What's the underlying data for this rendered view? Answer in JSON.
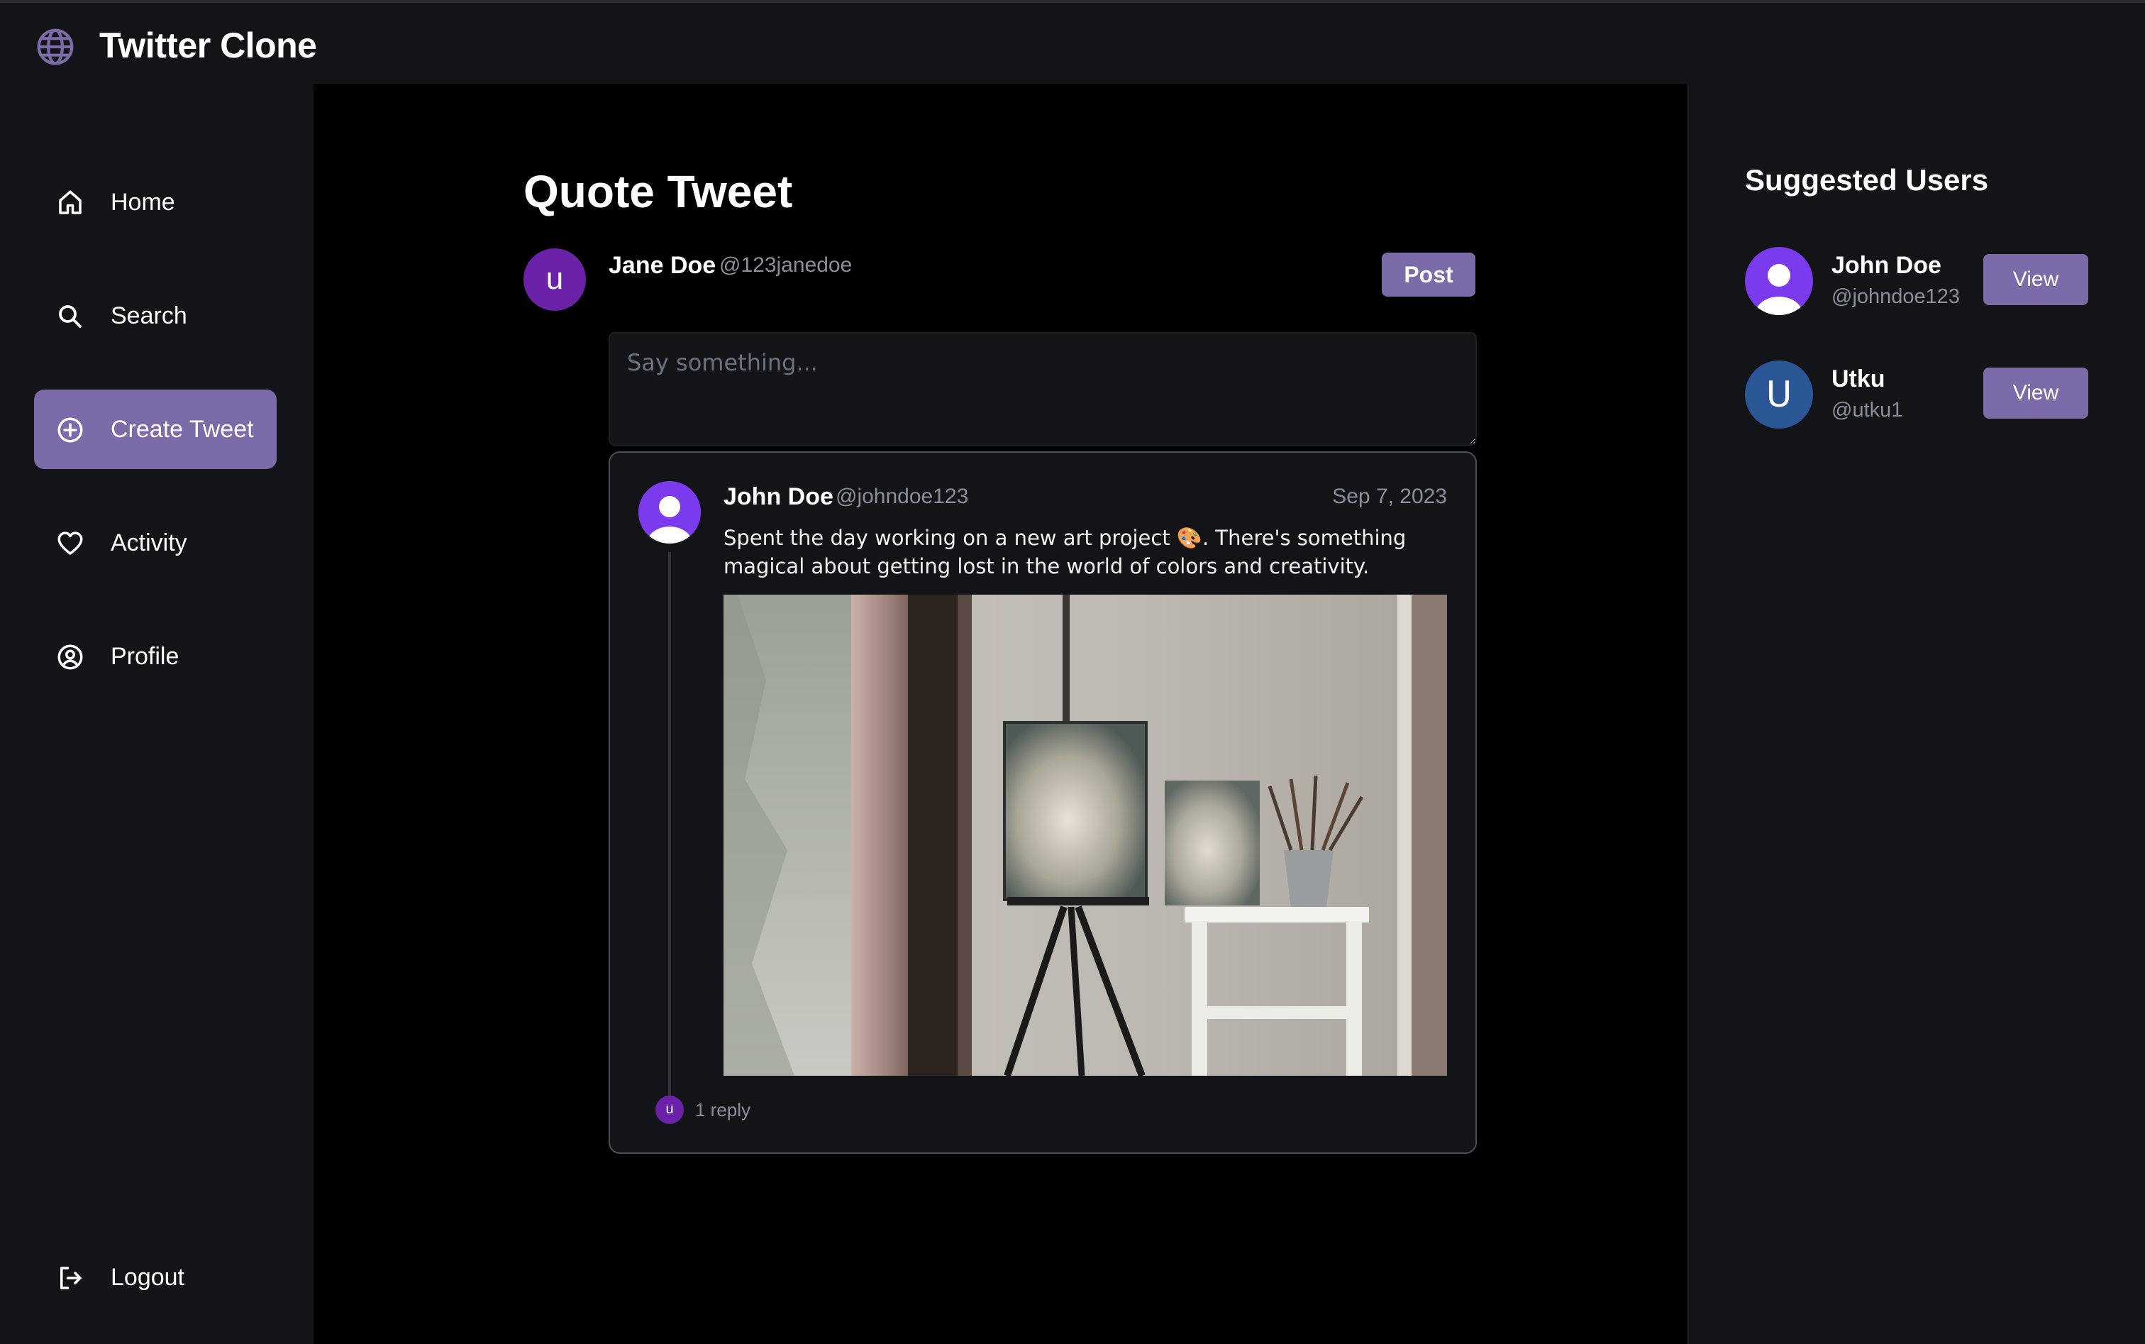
{
  "app": {
    "title": "Twitter Clone",
    "brand_icon": "globe-icon"
  },
  "colors": {
    "accent": "#7b6ba8",
    "panel": "#121417",
    "background": "#000000",
    "avatar_purple": "#6b21a8",
    "avatar_violet": "#7c3aed",
    "avatar_blue": "#2b5797"
  },
  "sidebar": {
    "items": [
      {
        "label": "Home",
        "icon": "home-icon",
        "active": false
      },
      {
        "label": "Search",
        "icon": "search-icon",
        "active": false
      },
      {
        "label": "Create Tweet",
        "icon": "plus-circle-icon",
        "active": true
      },
      {
        "label": "Activity",
        "icon": "heart-icon",
        "active": false
      },
      {
        "label": "Profile",
        "icon": "user-circle-icon",
        "active": false
      }
    ],
    "logout": {
      "label": "Logout",
      "icon": "logout-icon"
    }
  },
  "main": {
    "title": "Quote Tweet",
    "composer": {
      "avatar_letter": "u",
      "name": "Jane Doe",
      "handle": "@123janedoe",
      "post_label": "Post",
      "placeholder": "Say something...",
      "value": ""
    },
    "quoted_tweet": {
      "name": "John Doe",
      "handle": "@johndoe123",
      "date": "Sep 7, 2023",
      "text": "Spent the day working on a new art project 🎨. There's something magical about getting lost in the world of colors and creativity.",
      "image_description": "easel-with-painting-photo",
      "reply_avatar_letter": "u",
      "reply_count": "1 reply"
    }
  },
  "suggested": {
    "title": "Suggested Users",
    "users": [
      {
        "name": "John Doe",
        "handle": "@johndoe123",
        "avatar": "default-user-avatar",
        "button": "View"
      },
      {
        "name": "Utku",
        "handle": "@utku1",
        "avatar_letter": "U",
        "button": "View"
      }
    ]
  }
}
